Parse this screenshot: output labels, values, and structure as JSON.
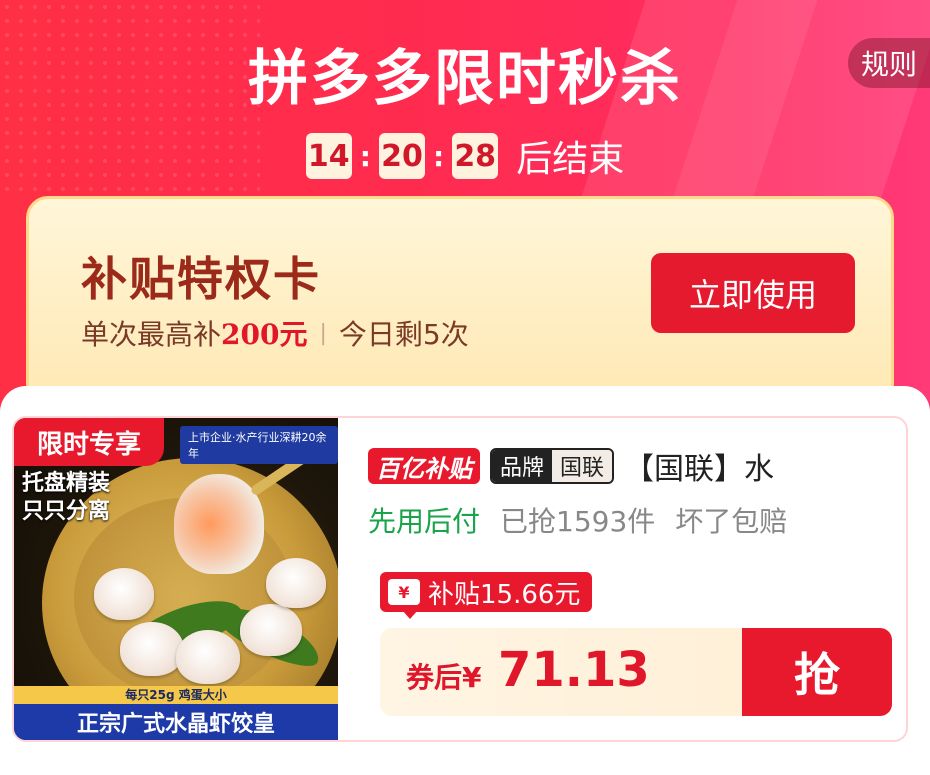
{
  "header": {
    "title": "拼多多限时秒杀",
    "rules_label": "规则",
    "countdown": {
      "hours": "14",
      "minutes": "20",
      "seconds": "28",
      "suffix": "后结束"
    }
  },
  "privilege_card": {
    "title": "补贴特权卡",
    "sub_prefix": "单次最高补",
    "sub_amount": "200元",
    "sub_remaining": "今日剩5次",
    "button_label": "立即使用"
  },
  "product": {
    "image_tags": {
      "limited": "限时专享",
      "corp": "上市企业·水产行业深耕20余年",
      "tray_line1": "托盘精装",
      "tray_line2": "只只分离",
      "size_note": "每只25g 鸡蛋大小",
      "name_banner": "正宗广式水晶虾饺皇"
    },
    "badge_subsidy": "百亿补贴",
    "badge_brand_left": "品牌",
    "badge_brand_right": "国联",
    "title": "【国联】水",
    "tags": {
      "pay_later": "先用后付",
      "sold": "已抢1593件",
      "guarantee": "坏了包赔"
    },
    "subsidy_icon": "¥",
    "subsidy_text": "补贴15.66元",
    "price_label": "券后",
    "price_currency": "¥",
    "price_value": "71.13",
    "grab_label": "抢"
  },
  "colors": {
    "primary_red": "#e8192d",
    "gold": "#ffe8b4",
    "green": "#1aa34a"
  }
}
